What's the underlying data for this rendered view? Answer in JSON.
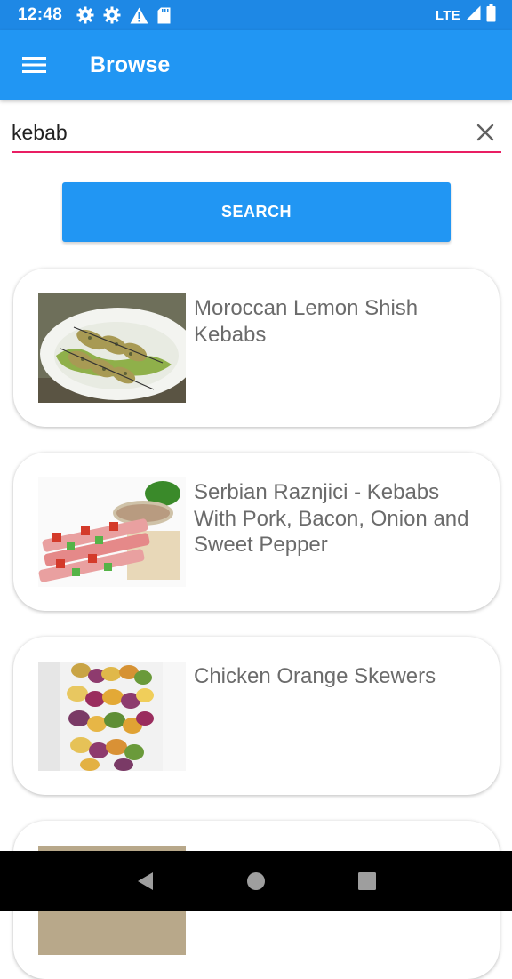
{
  "status_bar": {
    "time": "12:48",
    "network": "LTE",
    "icons": [
      "settings-icon",
      "settings-icon",
      "warning-icon",
      "sd-card-icon",
      "signal-icon",
      "battery-icon"
    ]
  },
  "app_bar": {
    "title": "Browse",
    "menu_icon": "hamburger-menu-icon",
    "color": "#2196f3"
  },
  "search": {
    "value": "kebab",
    "placeholder": "",
    "clear_icon": "close-icon",
    "underline_color": "#e91e63",
    "button_label": "SEARCH"
  },
  "results": [
    {
      "title": "Moroccan Lemon Shish Kebabs",
      "thumb": "chicken-skewers-on-plate-photo"
    },
    {
      "title": "Serbian Raznjici - Kebabs With Pork, Bacon, Onion and Sweet Pepper",
      "thumb": "pork-bacon-skewers-photo"
    },
    {
      "title": "Chicken Orange Skewers",
      "thumb": "chicken-orange-skewers-photo"
    },
    {
      "title": "",
      "thumb": "partially-visible-photo"
    }
  ],
  "nav_bar": {
    "icons": [
      "back-icon",
      "home-icon",
      "recents-icon"
    ]
  }
}
